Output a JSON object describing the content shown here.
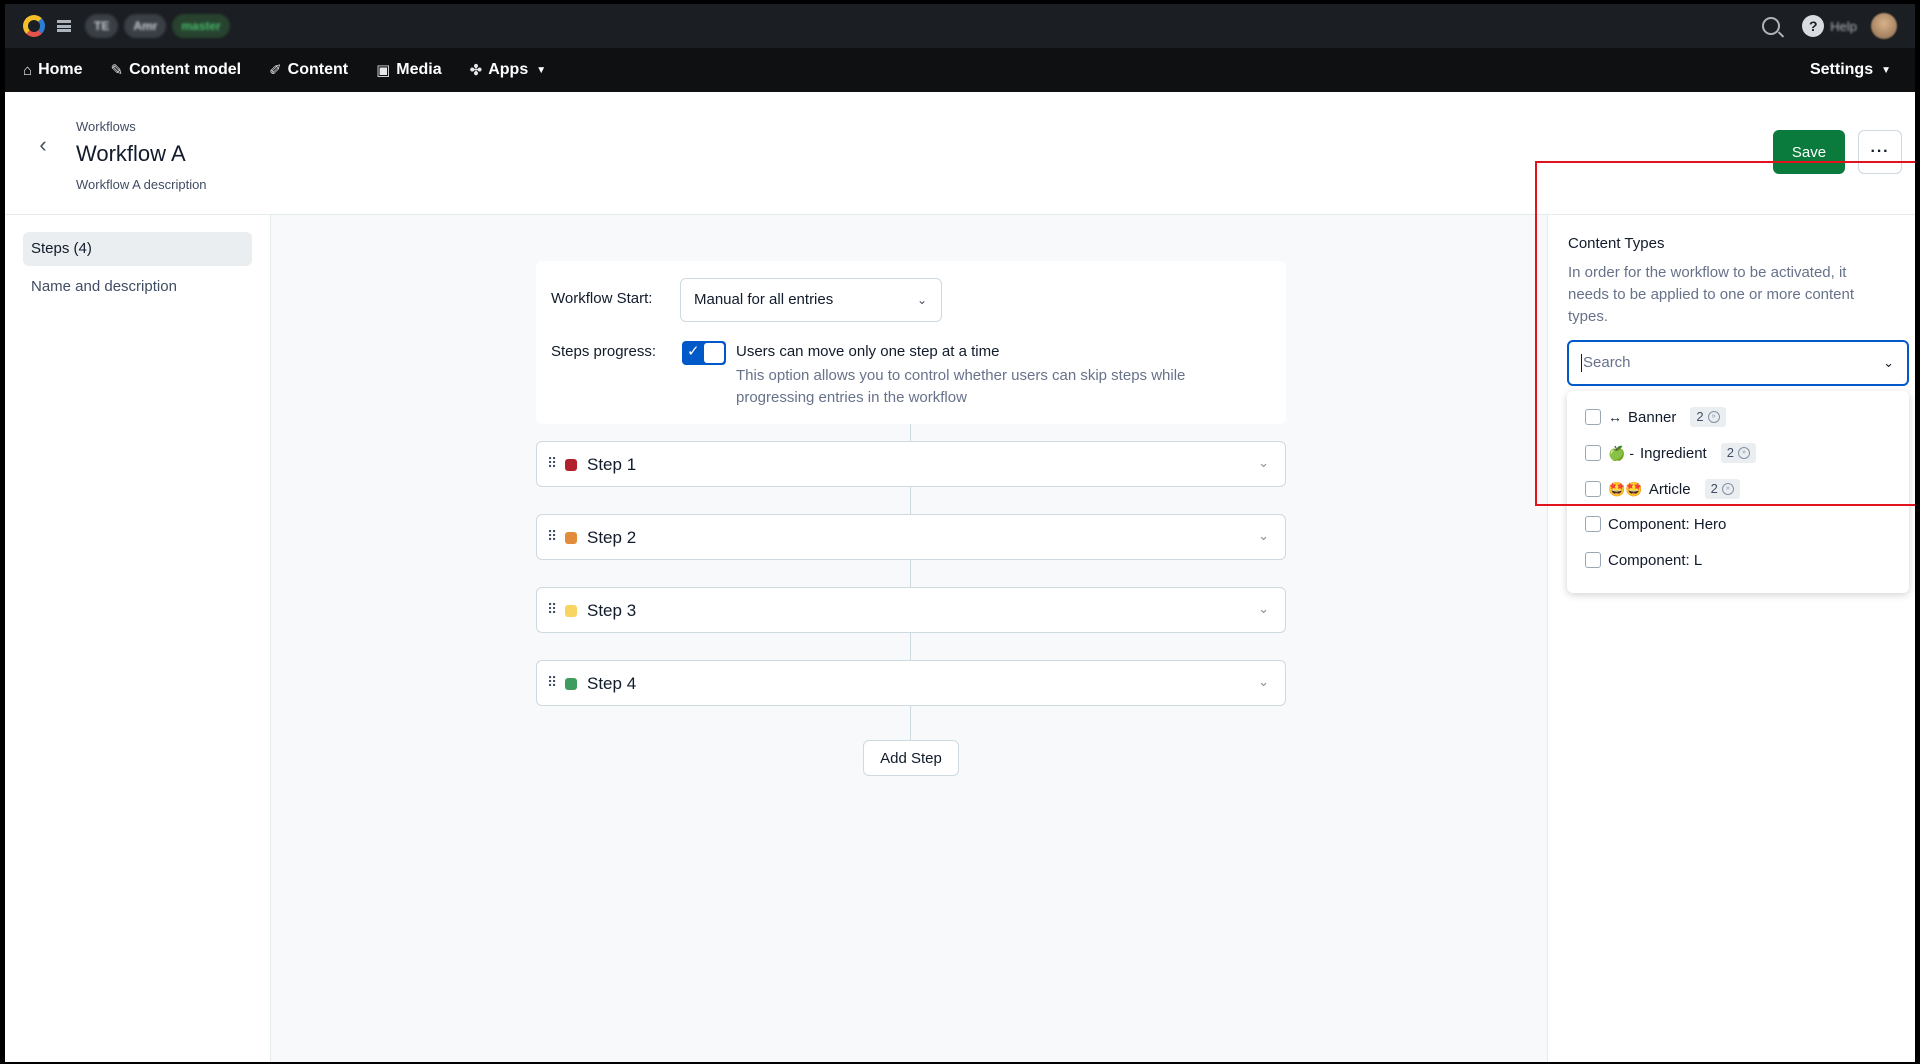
{
  "topbar": {
    "pills": [
      "TE",
      "Amr",
      "master"
    ],
    "help_label": "Help",
    "icons": [
      "logo-icon",
      "grid-icon",
      "search-icon",
      "help-icon",
      "avatar"
    ]
  },
  "nav": {
    "items": [
      {
        "label": "Home",
        "icon": "home-icon"
      },
      {
        "label": "Content model",
        "icon": "wrench-icon"
      },
      {
        "label": "Content",
        "icon": "pen-icon"
      },
      {
        "label": "Media",
        "icon": "image-icon"
      },
      {
        "label": "Apps",
        "icon": "puzzle-icon"
      }
    ],
    "settings_label": "Settings"
  },
  "header": {
    "breadcrumb": "Workflows",
    "title": "Workflow A",
    "description": "Workflow A description",
    "save_label": "Save",
    "more_label": "···"
  },
  "sidebar": {
    "items": [
      {
        "label": "Steps (4)",
        "active": true
      },
      {
        "label": "Name and description",
        "active": false
      }
    ]
  },
  "workflow": {
    "start_label": "Workflow Start:",
    "start_value": "Manual for all entries",
    "progress_label": "Steps progress:",
    "toggle_on": true,
    "option_title": "Users can move only one step at a time",
    "option_help": "This option allows you to control whether users can skip steps while progressing entries in the workflow"
  },
  "steps": [
    {
      "label": "Step 1",
      "color": "#b3202d"
    },
    {
      "label": "Step 2",
      "color": "#e28b3b"
    },
    {
      "label": "Step 3",
      "color": "#f7d560"
    },
    {
      "label": "Step 4",
      "color": "#3f9c5f"
    }
  ],
  "add_step_label": "Add Step",
  "content_types": {
    "title": "Content Types",
    "help": "In order for the workflow to be activated, it needs to be applied to one or more content types.",
    "search_placeholder": "Search",
    "items": [
      {
        "prefix": "↔",
        "label": "Banner",
        "badge": "2"
      },
      {
        "prefix": "🍏 -",
        "label": "Ingredient",
        "badge": "2"
      },
      {
        "prefix": "🤩🤩",
        "label": "Article",
        "badge": "2"
      },
      {
        "prefix": "",
        "label": "Component: Hero",
        "badge": ""
      },
      {
        "prefix": "",
        "label": "Component: L",
        "badge": ""
      }
    ]
  },
  "accent_colors": {
    "primary": "#0059c8",
    "save": "#0a7b3c",
    "highlight": "#e1141d"
  }
}
